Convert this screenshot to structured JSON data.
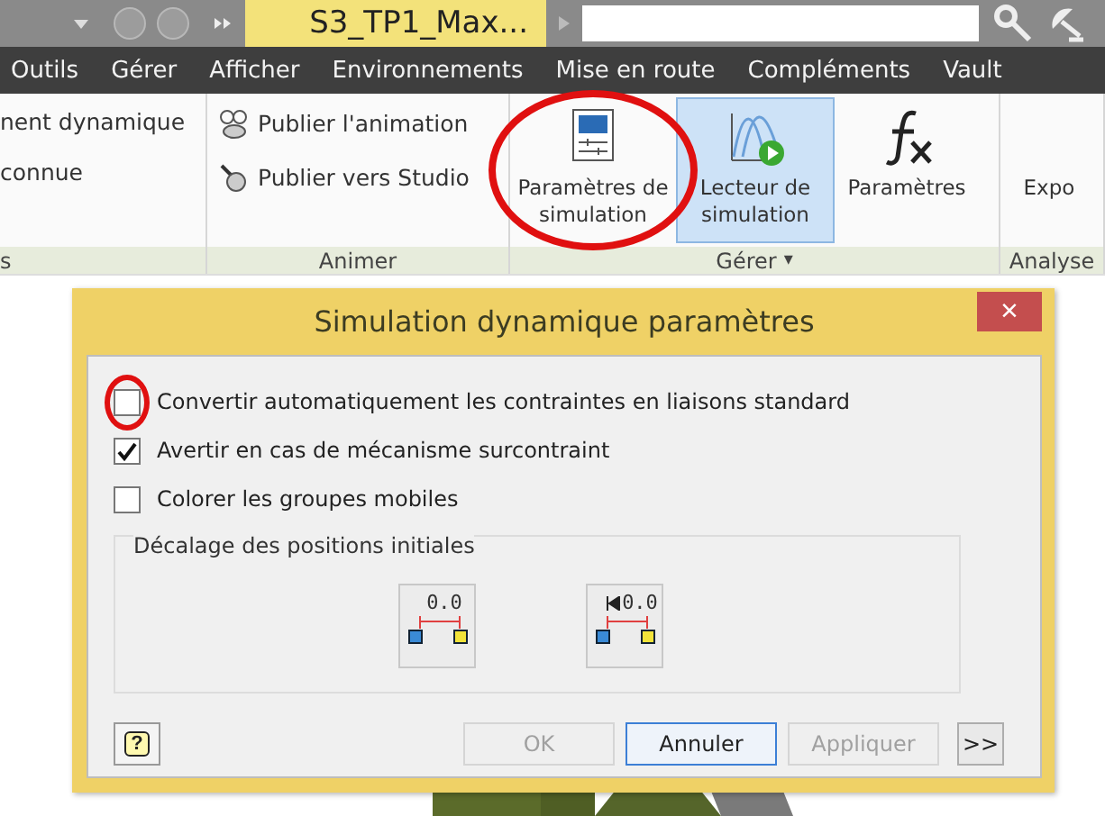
{
  "title_bar": {
    "document_tab": "S3_TP1_Max..."
  },
  "menu": [
    {
      "label": "Outils"
    },
    {
      "label": "Gérer"
    },
    {
      "label": "Afficher"
    },
    {
      "label": "Environnements"
    },
    {
      "label": "Mise en route"
    },
    {
      "label": "Compléments"
    },
    {
      "label": "Vault"
    }
  ],
  "ribbon": {
    "groups": [
      {
        "kind": "list",
        "label": "s",
        "items": [
          {
            "label": "nent dynamique"
          },
          {
            "label": "connue"
          }
        ]
      },
      {
        "kind": "iconlist",
        "label": "Animer",
        "items": [
          {
            "label": "Publier l'animation"
          },
          {
            "label": "Publier vers Studio"
          }
        ]
      },
      {
        "kind": "large",
        "label": "Gérer",
        "dropdown": "▾",
        "items": [
          {
            "label": "Paramètres de simulation",
            "selected": false,
            "circled": true
          },
          {
            "label": "Lecteur de simulation",
            "selected": true,
            "circled": false
          },
          {
            "label": "Paramètres",
            "selected": false,
            "circled": false
          }
        ]
      },
      {
        "kind": "large",
        "label": "Analyse",
        "items": [
          {
            "label": "Expo",
            "selected": false,
            "circled": false
          }
        ]
      }
    ]
  },
  "dialog": {
    "title": "Simulation dynamique paramètres",
    "close": "×",
    "options": [
      {
        "label": "Convertir automatiquement les contraintes en liaisons standard",
        "checked": false,
        "circled": true
      },
      {
        "label": "Avertir en cas de mécanisme surcontraint",
        "checked": true,
        "circled": false
      },
      {
        "label": "Colorer les groupes mobiles",
        "checked": false,
        "circled": false
      }
    ],
    "offset_group": {
      "label": "Décalage des positions initiales",
      "buttons": [
        {
          "value": "0.0",
          "kind": "plain"
        },
        {
          "value": "0.0",
          "kind": "reset"
        }
      ]
    },
    "help": "?",
    "buttons": [
      {
        "label": "OK",
        "disabled": true,
        "default": false
      },
      {
        "label": "Annuler",
        "disabled": false,
        "default": true
      },
      {
        "label": "Appliquer",
        "disabled": true,
        "default": false
      },
      {
        "label": ">>",
        "disabled": false,
        "default": false
      }
    ]
  }
}
